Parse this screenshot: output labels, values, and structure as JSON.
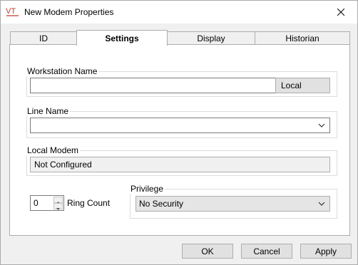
{
  "window": {
    "title": "New Modem Properties",
    "app_logo": "VT"
  },
  "tabs": [
    {
      "label": "ID"
    },
    {
      "label": "Settings"
    },
    {
      "label": "Display"
    },
    {
      "label": "Historian"
    }
  ],
  "settings": {
    "workstation": {
      "label": "Workstation Name",
      "value": "",
      "button_label": "Local"
    },
    "line": {
      "label": "Line Name",
      "selected": ""
    },
    "local_modem": {
      "label": "Local Modem",
      "value": "Not Configured"
    },
    "ring_count": {
      "value": "0",
      "label": "Ring Count"
    },
    "privilege": {
      "label": "Privilege",
      "selected": "No Security"
    }
  },
  "buttons": {
    "ok": "OK",
    "cancel": "Cancel",
    "apply": "Apply"
  },
  "colors": {
    "logo_red": "#c0392b",
    "accent_border": "#7a7a7a"
  }
}
